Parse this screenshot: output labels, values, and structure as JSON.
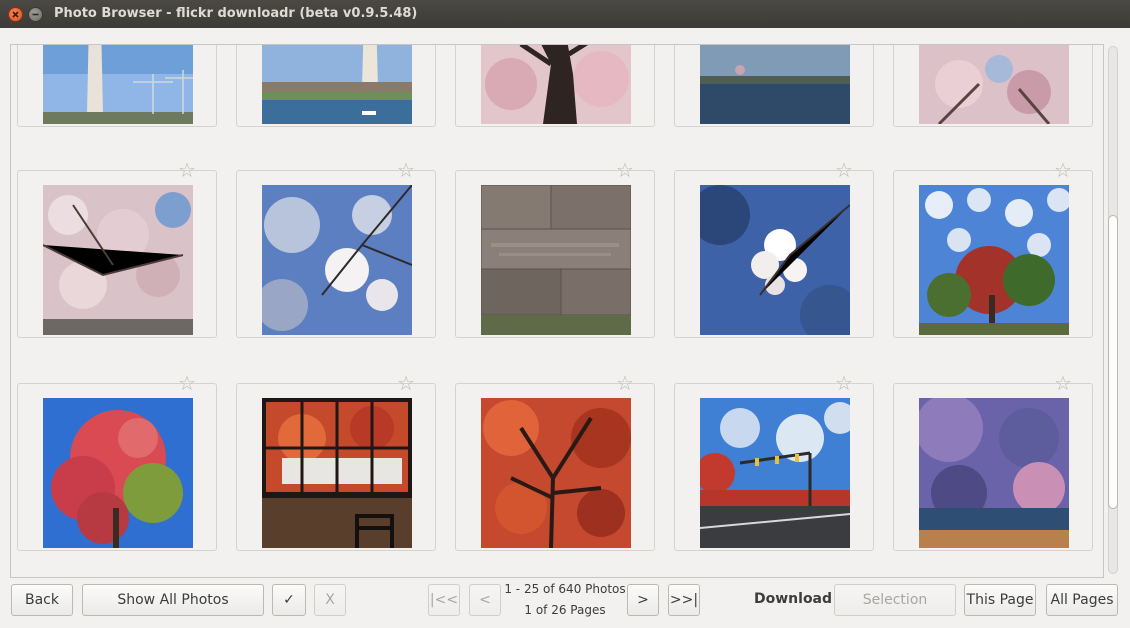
{
  "window": {
    "title": "Photo Browser - flickr downloadr (beta v0.9.5.48)"
  },
  "icons": {
    "star": "star-outline-icon",
    "close": "close-icon",
    "minimize": "minimize-icon"
  },
  "rows": [
    {
      "photos": [
        {
          "name": "washington-monument-cranes",
          "starred": false
        },
        {
          "name": "monument-tidal-basin",
          "starred": false
        },
        {
          "name": "blossom-tree-trunk",
          "starred": false
        },
        {
          "name": "tidal-basin-water",
          "starred": false
        },
        {
          "name": "blossom-canopy",
          "starred": false
        }
      ]
    },
    {
      "photos": [
        {
          "name": "cherry-blossoms-dense",
          "starred": false
        },
        {
          "name": "blossom-branch-sky",
          "starred": false
        },
        {
          "name": "fdr-memorial-wall",
          "starred": false
        },
        {
          "name": "blossom-closeup",
          "starred": false
        },
        {
          "name": "red-tree-clouds",
          "starred": false
        }
      ]
    },
    {
      "photos": [
        {
          "name": "red-maple-tree",
          "starred": false
        },
        {
          "name": "window-autumn-tree",
          "starred": false
        },
        {
          "name": "red-tree-branches",
          "starred": false
        },
        {
          "name": "street-traffic-light",
          "starred": false
        },
        {
          "name": "beach-sunset-sky",
          "starred": false
        }
      ]
    }
  ],
  "toolbar": {
    "back": "Back",
    "show_all": "Show All Photos",
    "select_all": "✓",
    "deselect": "X",
    "first": "|<<",
    "prev": "<",
    "photos_range": "1 - 25 of 640 Photos",
    "pages": "1 of 26 Pages",
    "next": ">",
    "last": ">>|",
    "download_label": "Download",
    "selection": "Selection",
    "this_page": "This Page",
    "all_pages": "All Pages"
  }
}
